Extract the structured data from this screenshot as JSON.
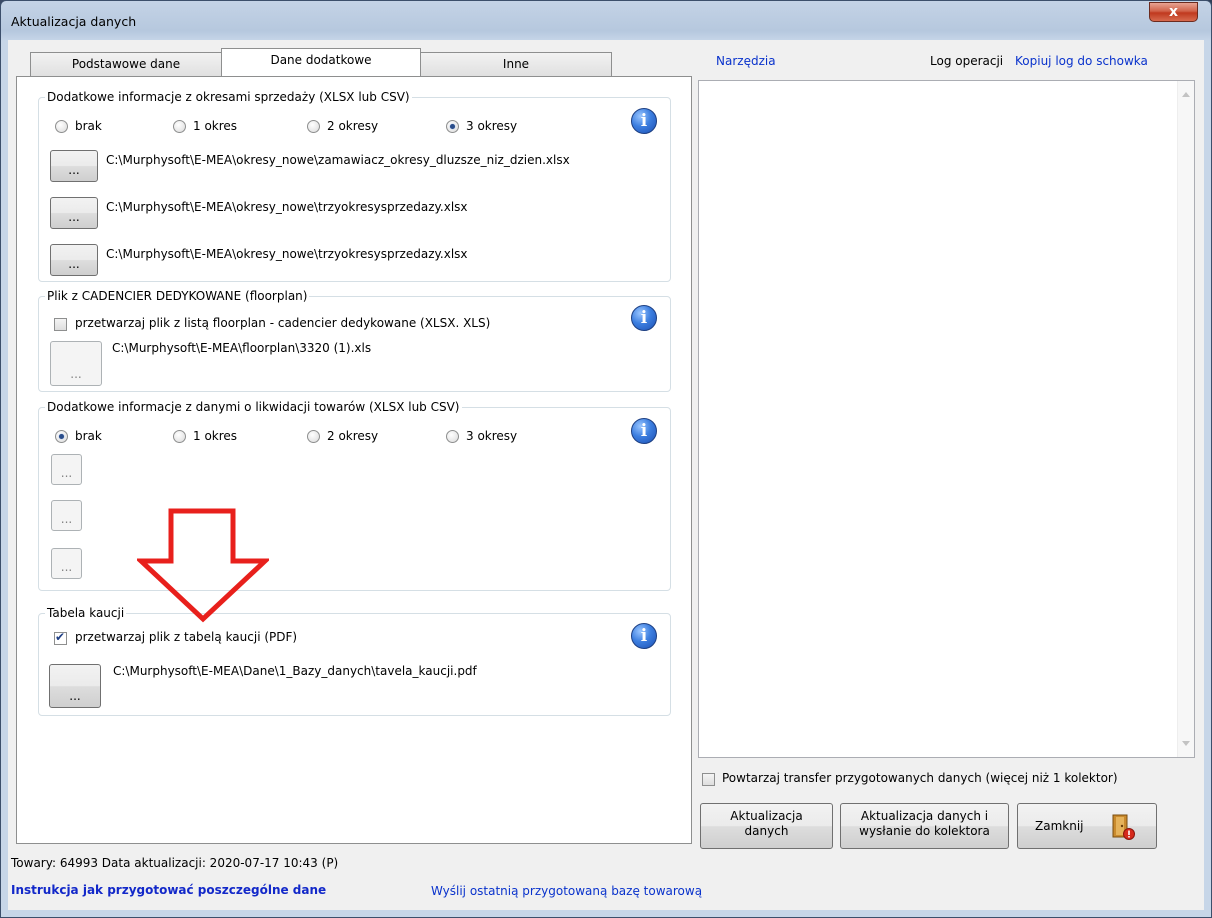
{
  "window": {
    "title": "Aktualizacja danych",
    "close_glyph": "x"
  },
  "tabs": [
    {
      "label": "Podstawowe dane",
      "active": false
    },
    {
      "label": "Dane dodatkowe",
      "active": true
    },
    {
      "label": "Inne",
      "active": false
    }
  ],
  "groups": {
    "sales_periods": {
      "title": "Dodatkowe informacje z okresami sprzedaży (XLSX lub CSV)",
      "options": [
        "brak",
        "1 okres",
        "2 okresy",
        "3 okresy"
      ],
      "selected": "3 okresy",
      "files": [
        "C:\\Murphysoft\\E-MEA\\okresy_nowe\\zamawiacz_okresy_dluzsze_niz_dzien.xlsx",
        "C:\\Murphysoft\\E-MEA\\okresy_nowe\\trzyokresysprzedazy.xlsx",
        "C:\\Murphysoft\\E-MEA\\okresy_nowe\\trzyokresysprzedazy.xlsx"
      ]
    },
    "cadencier": {
      "title": "Plik z CADENCIER DEDYKOWANE (floorplan)",
      "checkbox_label": "przetwarzaj plik z listą floorplan - cadencier dedykowane (XLSX. XLS)",
      "checked": false,
      "file": "C:\\Murphysoft\\E-MEA\\floorplan\\3320 (1).xls"
    },
    "liquidation": {
      "title": "Dodatkowe informacje z danymi o likwidacji towarów (XLSX lub CSV)",
      "options": [
        "brak",
        "1 okres",
        "2 okresy",
        "3 okresy"
      ],
      "selected": "brak"
    },
    "deposit": {
      "title": "Tabela kaucji",
      "checkbox_label": "przetwarzaj plik z tabelą kaucji (PDF)",
      "checked": true,
      "file": "C:\\Murphysoft\\E-MEA\\Dane\\1_Bazy_danych\\tavela_kaucji.pdf"
    }
  },
  "browse_label": "...",
  "info_glyph": "i",
  "right_panel": {
    "tools_link": "Narzędzia",
    "log_label": "Log operacji",
    "copy_log_link": "Kopiuj log do schowka",
    "repeat_checkbox_label": "Powtarzaj transfer przygotowanych danych (więcej niż 1 kolektor)",
    "repeat_checked": false,
    "buttons": {
      "update_line1": "Aktualizacja",
      "update_line2": "danych",
      "update_send_line1": "Aktualizacja danych  i",
      "update_send_line2": "wysłanie do kolektora",
      "close": "Zamknij"
    }
  },
  "status": {
    "summary": "Towary: 64993  Data aktualizacji: 2020-07-17 10:43 (P)",
    "instructions_link": "Instrukcja jak przygotować poszczególne dane",
    "send_last_link": "Wyślij ostatnią przygotowaną bazę towarową"
  },
  "colors": {
    "link": "#0a33cc",
    "annotation_arrow": "#e8201c",
    "info_icon": "#2f6fd6"
  },
  "icons": [
    "close-icon",
    "info-icon",
    "exit-door-icon",
    "red-arrow-annotation"
  ]
}
